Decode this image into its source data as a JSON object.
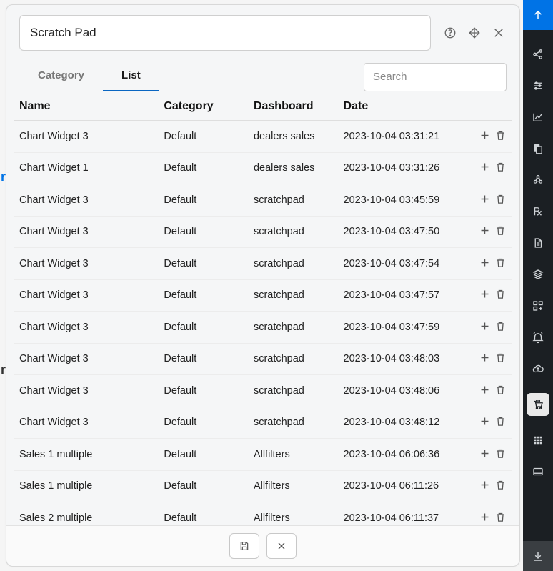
{
  "header": {
    "title_value": "Scratch Pad"
  },
  "tabs": {
    "category": "Category",
    "list": "List",
    "active": "list"
  },
  "search": {
    "placeholder": "Search",
    "value": ""
  },
  "table": {
    "columns": {
      "name": "Name",
      "category": "Category",
      "dashboard": "Dashboard",
      "date": "Date"
    },
    "rows": [
      {
        "name": "Chart Widget 3",
        "category": "Default",
        "dashboard": "dealers sales",
        "date": "2023-10-04 03:31:21"
      },
      {
        "name": "Chart Widget 1",
        "category": "Default",
        "dashboard": "dealers sales",
        "date": "2023-10-04 03:31:26"
      },
      {
        "name": "Chart Widget 3",
        "category": "Default",
        "dashboard": "scratchpad",
        "date": "2023-10-04 03:45:59"
      },
      {
        "name": "Chart Widget 3",
        "category": "Default",
        "dashboard": "scratchpad",
        "date": "2023-10-04 03:47:50"
      },
      {
        "name": "Chart Widget 3",
        "category": "Default",
        "dashboard": "scratchpad",
        "date": "2023-10-04 03:47:54"
      },
      {
        "name": "Chart Widget 3",
        "category": "Default",
        "dashboard": "scratchpad",
        "date": "2023-10-04 03:47:57"
      },
      {
        "name": "Chart Widget 3",
        "category": "Default",
        "dashboard": "scratchpad",
        "date": "2023-10-04 03:47:59"
      },
      {
        "name": "Chart Widget 3",
        "category": "Default",
        "dashboard": "scratchpad",
        "date": "2023-10-04 03:48:03"
      },
      {
        "name": "Chart Widget 3",
        "category": "Default",
        "dashboard": "scratchpad",
        "date": "2023-10-04 03:48:06"
      },
      {
        "name": "Chart Widget 3",
        "category": "Default",
        "dashboard": "scratchpad",
        "date": "2023-10-04 03:48:12"
      },
      {
        "name": "Sales 1 multiple",
        "category": "Default",
        "dashboard": "Allfilters",
        "date": "2023-10-04 06:06:36"
      },
      {
        "name": "Sales 1 multiple",
        "category": "Default",
        "dashboard": "Allfilters",
        "date": "2023-10-04 06:11:26"
      },
      {
        "name": "Sales 2 multiple",
        "category": "Default",
        "dashboard": "Allfilters",
        "date": "2023-10-04 06:11:37"
      }
    ]
  },
  "sidebar_icons": [
    "share-icon",
    "sliders-icon",
    "chart-icon",
    "copy-icon",
    "cube-icon",
    "rx-icon",
    "document-icon",
    "layers-icon",
    "grid-icon",
    "bell-icon",
    "cloud-icon",
    "cart-icon",
    "apps-icon",
    "panel-icon"
  ],
  "colors": {
    "accent": "#0073e6",
    "sidebar_bg": "#1b1f23"
  }
}
